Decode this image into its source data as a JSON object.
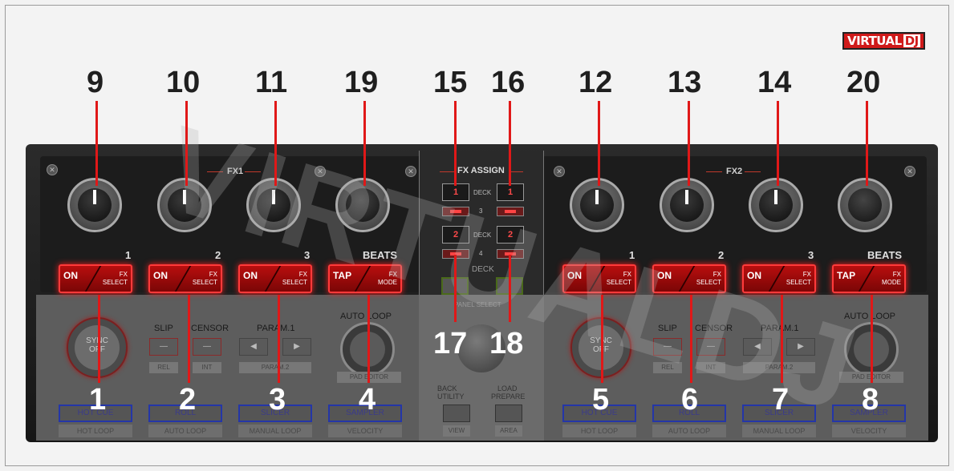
{
  "logo": {
    "virtual": "VIRTUAL",
    "dj": "DJ"
  },
  "watermark": "VIRTUALDJ",
  "callouts_top": [
    "9",
    "10",
    "11",
    "19",
    "15",
    "16",
    "12",
    "13",
    "14",
    "20"
  ],
  "callouts_bottom": [
    "1",
    "2",
    "3",
    "4",
    "17",
    "18",
    "5",
    "6",
    "7",
    "8"
  ],
  "left_unit": {
    "section_label": "FX1",
    "knob_numbers": [
      "1",
      "2",
      "3"
    ],
    "beats_label": "BEATS",
    "buttons": [
      {
        "left": "ON",
        "right1": "FX",
        "right2": "SELECT"
      },
      {
        "left": "ON",
        "right1": "FX",
        "right2": "SELECT"
      },
      {
        "left": "ON",
        "right1": "FX",
        "right2": "SELECT"
      },
      {
        "left": "TAP",
        "right1": "FX",
        "right2": "MODE"
      }
    ]
  },
  "right_unit": {
    "section_label": "FX2",
    "knob_numbers": [
      "1",
      "2",
      "3"
    ],
    "beats_label": "BEATS",
    "buttons": [
      {
        "left": "ON",
        "right1": "FX",
        "right2": "SELECT"
      },
      {
        "left": "ON",
        "right1": "FX",
        "right2": "SELECT"
      },
      {
        "left": "ON",
        "right1": "FX",
        "right2": "SELECT"
      },
      {
        "left": "TAP",
        "right1": "FX",
        "right2": "MODE"
      }
    ]
  },
  "lower": {
    "sync": "SYNC",
    "sync_off": "OFF",
    "slip": "SLIP",
    "censor": "CENSOR",
    "rel": "REL",
    "int": "INT",
    "param1": "PARAM.1",
    "param2": "PARAM.2",
    "auto_loop": "AUTO LOOP",
    "pad_label": "PAD EDITOR",
    "pads": [
      "HOT CUE",
      "ROLL",
      "SLICER",
      "SAMPLER"
    ],
    "pad_subs": [
      "HOT LOOP",
      "AUTO LOOP",
      "MANUAL LOOP",
      "VELOCITY"
    ]
  },
  "center": {
    "fx_assign": "FX ASSIGN",
    "deck": "DECK",
    "row1": [
      "1",
      "1"
    ],
    "row2_num": "3",
    "row3": [
      "2",
      "2"
    ],
    "row4_num": "4",
    "deck2": "DECK",
    "panel_select": "PANEL SELECT",
    "back": "BACK",
    "utility": "UTILITY",
    "load": "LOAD",
    "prepare": "PREPARE",
    "view": "VIEW",
    "area": "AREA"
  }
}
